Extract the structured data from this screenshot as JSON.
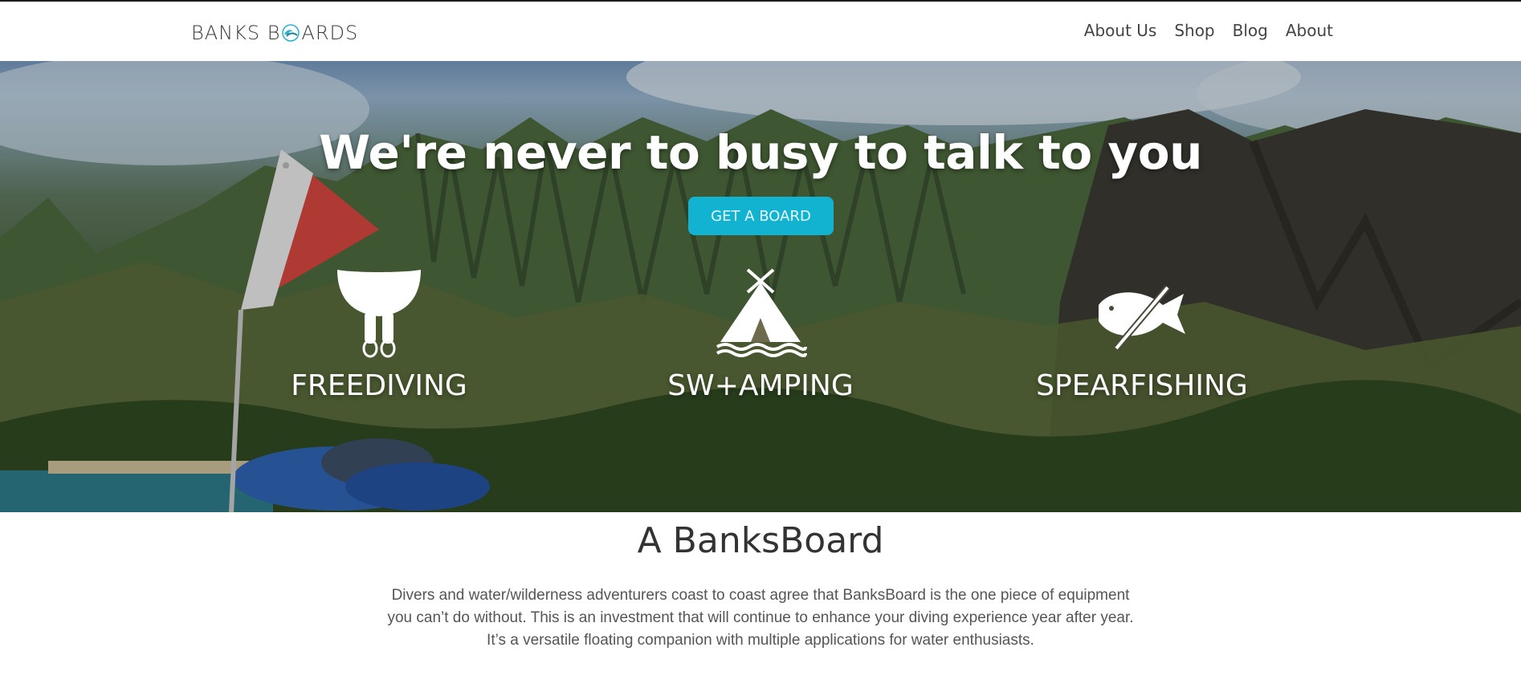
{
  "nav": {
    "logo_left": "BANKS B",
    "logo_right": "ARDS",
    "links": [
      "About Us",
      "Shop",
      "Blog",
      "About"
    ]
  },
  "hero": {
    "title": "We're never to busy to talk to you",
    "cta_label": "GET A BOARD",
    "activities": [
      {
        "label": "FREEDIVING",
        "icon": "fins-icon"
      },
      {
        "label": "SW+AMPING",
        "icon": "teepee-icon"
      },
      {
        "label": "SPEARFISHING",
        "icon": "fish-spear-icon"
      }
    ]
  },
  "intro": {
    "title": "A BanksBoard",
    "body_lines": [
      "Divers and water/wilderness adventurers coast to coast agree that BanksBoard is the one piece of equipment",
      "you can’t do without. This is an investment that will continue to enhance your diving experience year after year.",
      "It’s a versatile floating companion with multiple applications for water enthusiasts."
    ]
  },
  "colors": {
    "accent": "#12b3d1",
    "text": "#333333",
    "nav_text": "#444444"
  }
}
